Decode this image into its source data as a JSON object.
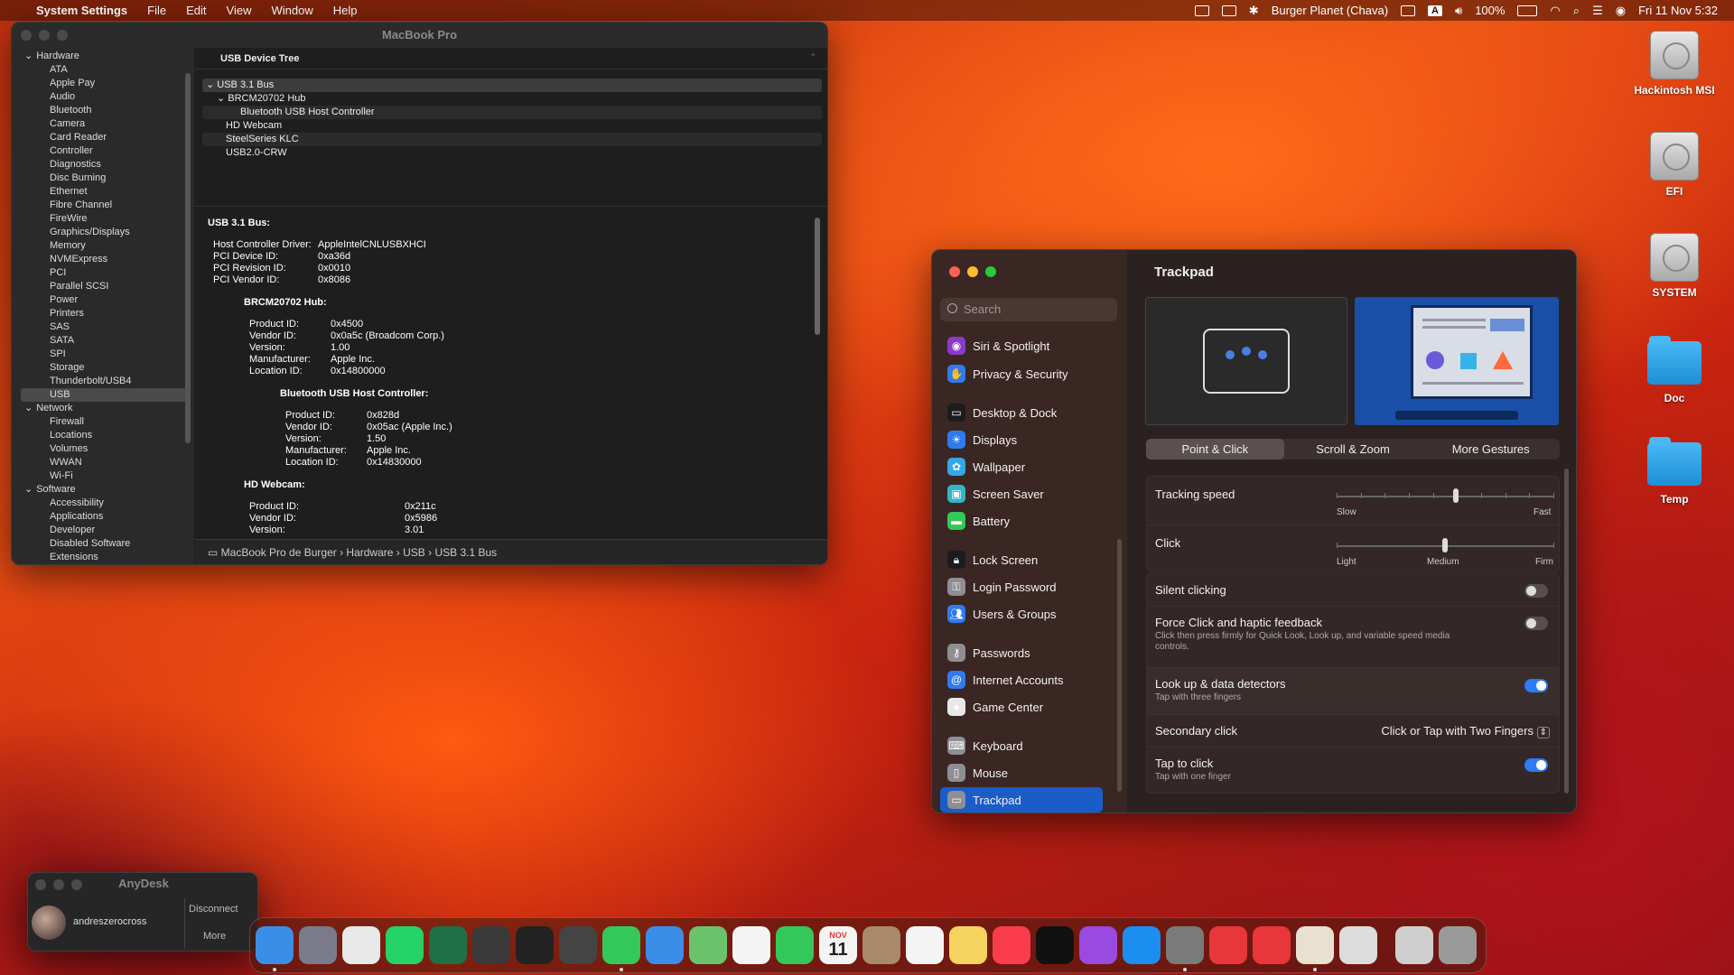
{
  "menubar": {
    "app": "System Settings",
    "menus": [
      "File",
      "Edit",
      "View",
      "Window",
      "Help"
    ],
    "wifi_name": "Burger Planet (Chava)",
    "input_letter": "A",
    "battery": "100%",
    "clock": "Fri 11 Nov  5:32"
  },
  "sysinfo": {
    "title": "MacBook Pro",
    "groups": [
      {
        "label": "Hardware",
        "items": [
          "ATA",
          "Apple Pay",
          "Audio",
          "Bluetooth",
          "Camera",
          "Card Reader",
          "Controller",
          "Diagnostics",
          "Disc Burning",
          "Ethernet",
          "Fibre Channel",
          "FireWire",
          "Graphics/Displays",
          "Memory",
          "NVMExpress",
          "PCI",
          "Parallel SCSI",
          "Power",
          "Printers",
          "SAS",
          "SATA",
          "SPI",
          "Storage",
          "Thunderbolt/USB4",
          "USB"
        ]
      },
      {
        "label": "Network",
        "items": [
          "Firewall",
          "Locations",
          "Volumes",
          "WWAN",
          "Wi-Fi"
        ]
      },
      {
        "label": "Software",
        "items": [
          "Accessibility",
          "Applications",
          "Developer",
          "Disabled Software",
          "Extensions"
        ]
      }
    ],
    "selected": "USB",
    "tree_header": "USB Device Tree",
    "tree": [
      "USB 3.1 Bus",
      "BRCM20702 Hub",
      "Bluetooth USB Host Controller",
      "HD Webcam",
      "SteelSeries KLC",
      "USB2.0-CRW"
    ],
    "detail": {
      "bus_title": "USB 3.1 Bus:",
      "bus": [
        [
          "Host Controller Driver:",
          "AppleIntelCNLUSBXHCI"
        ],
        [
          "PCI Device ID:",
          "0xa36d"
        ],
        [
          "PCI Revision ID:",
          "0x0010"
        ],
        [
          "PCI Vendor ID:",
          "0x8086"
        ]
      ],
      "hub_title": "BRCM20702 Hub:",
      "hub": [
        [
          "Product ID:",
          "0x4500"
        ],
        [
          "Vendor ID:",
          "0x0a5c  (Broadcom Corp.)"
        ],
        [
          "Version:",
          "1.00"
        ],
        [
          "Manufacturer:",
          "Apple Inc."
        ],
        [
          "Location ID:",
          "0x14800000"
        ]
      ],
      "bt_title": "Bluetooth USB Host Controller:",
      "bt": [
        [
          "Product ID:",
          "0x828d"
        ],
        [
          "Vendor ID:",
          "0x05ac (Apple Inc.)"
        ],
        [
          "Version:",
          "1.50"
        ],
        [
          "Manufacturer:",
          "Apple Inc."
        ],
        [
          "Location ID:",
          "0x14830000"
        ]
      ],
      "cam_title": "HD Webcam:",
      "cam": [
        [
          "Product ID:",
          "0x211c"
        ],
        [
          "Vendor ID:",
          "0x5986"
        ],
        [
          "Version:",
          "3.01"
        ]
      ]
    },
    "path": [
      "MacBook Pro de Burger",
      "Hardware",
      "USB",
      "USB 3.1 Bus"
    ]
  },
  "settings": {
    "search_placeholder": "Search",
    "nav": [
      {
        "label": "Siri & Spotlight",
        "icon": "siri-icon",
        "color": "#8a3ac8"
      },
      {
        "label": "Privacy & Security",
        "icon": "hand-icon",
        "color": "#2f7af0"
      },
      {
        "label": "Desktop & Dock",
        "icon": "dock-icon",
        "color": "#1c1c1e"
      },
      {
        "label": "Displays",
        "icon": "sun-icon",
        "color": "#2f7af0"
      },
      {
        "label": "Wallpaper",
        "icon": "flower-icon",
        "color": "#33a8e8"
      },
      {
        "label": "Screen Saver",
        "icon": "screensaver-icon",
        "color": "#34b4c8"
      },
      {
        "label": "Battery",
        "icon": "battery-icon",
        "color": "#34c759"
      },
      {
        "label": "Lock Screen",
        "icon": "lock-icon",
        "color": "#1c1c1e"
      },
      {
        "label": "Login Password",
        "icon": "key-lock-icon",
        "color": "#8e8e93"
      },
      {
        "label": "Users & Groups",
        "icon": "users-icon",
        "color": "#2f7af0"
      },
      {
        "label": "Passwords",
        "icon": "key-icon",
        "color": "#8e8e93"
      },
      {
        "label": "Internet Accounts",
        "icon": "at-icon",
        "color": "#2f7af0"
      },
      {
        "label": "Game Center",
        "icon": "gamecenter-icon",
        "color": "#e8e8e8"
      },
      {
        "label": "Keyboard",
        "icon": "keyboard-icon",
        "color": "#8e8e93"
      },
      {
        "label": "Mouse",
        "icon": "mouse-icon",
        "color": "#8e8e93"
      },
      {
        "label": "Trackpad",
        "icon": "trackpad-icon",
        "color": "#8e8e93"
      }
    ],
    "selected": "Trackpad",
    "pane_title": "Trackpad",
    "tabs": [
      "Point & Click",
      "Scroll & Zoom",
      "More Gestures"
    ],
    "active_tab": "Point & Click",
    "tracking": {
      "label": "Tracking speed",
      "min": "Slow",
      "max": "Fast",
      "value": 0.55
    },
    "click": {
      "label": "Click",
      "min": "Light",
      "mid": "Medium",
      "max": "Firm",
      "value": 0.5
    },
    "silent": {
      "label": "Silent clicking",
      "on": false
    },
    "force": {
      "label": "Force Click and haptic feedback",
      "sub": "Click then press firmly for Quick Look, Look up, and variable speed media controls.",
      "on": false
    },
    "lookup": {
      "label": "Look up & data detectors",
      "sub": "Tap with three fingers",
      "on": true
    },
    "secondary": {
      "label": "Secondary click",
      "value": "Click or Tap with Two Fingers"
    },
    "tap": {
      "label": "Tap to click",
      "sub": "Tap with one finger",
      "on": true
    }
  },
  "desktop": [
    "Hackintosh MSI",
    "EFI",
    "SYSTEM",
    "Doc",
    "Temp"
  ],
  "anydesk": {
    "title": "AnyDesk",
    "user": "andreszerocross",
    "disconnect": "Disconnect",
    "more": "More"
  },
  "dock": [
    "finder-icon",
    "launchpad-icon",
    "chrome-icon",
    "whatsapp-icon",
    "excel-icon",
    "calculator-icon",
    "davinci-icon",
    "screenshot-icon",
    "messages-icon",
    "mail-icon",
    "maps-icon",
    "photos-icon",
    "facetime-icon",
    "calendar-icon",
    "contacts-icon",
    "reminders-icon",
    "notes-icon",
    "music-icon",
    "appletv-icon",
    "podcasts-icon",
    "appstore-icon",
    "settings-icon",
    "anydesk-icon",
    "anydesk-alt-icon",
    "preview-icon",
    "printer-icon",
    "downloads-icon",
    "trash-icon"
  ],
  "calendar": {
    "month": "NOV",
    "day": "11"
  }
}
